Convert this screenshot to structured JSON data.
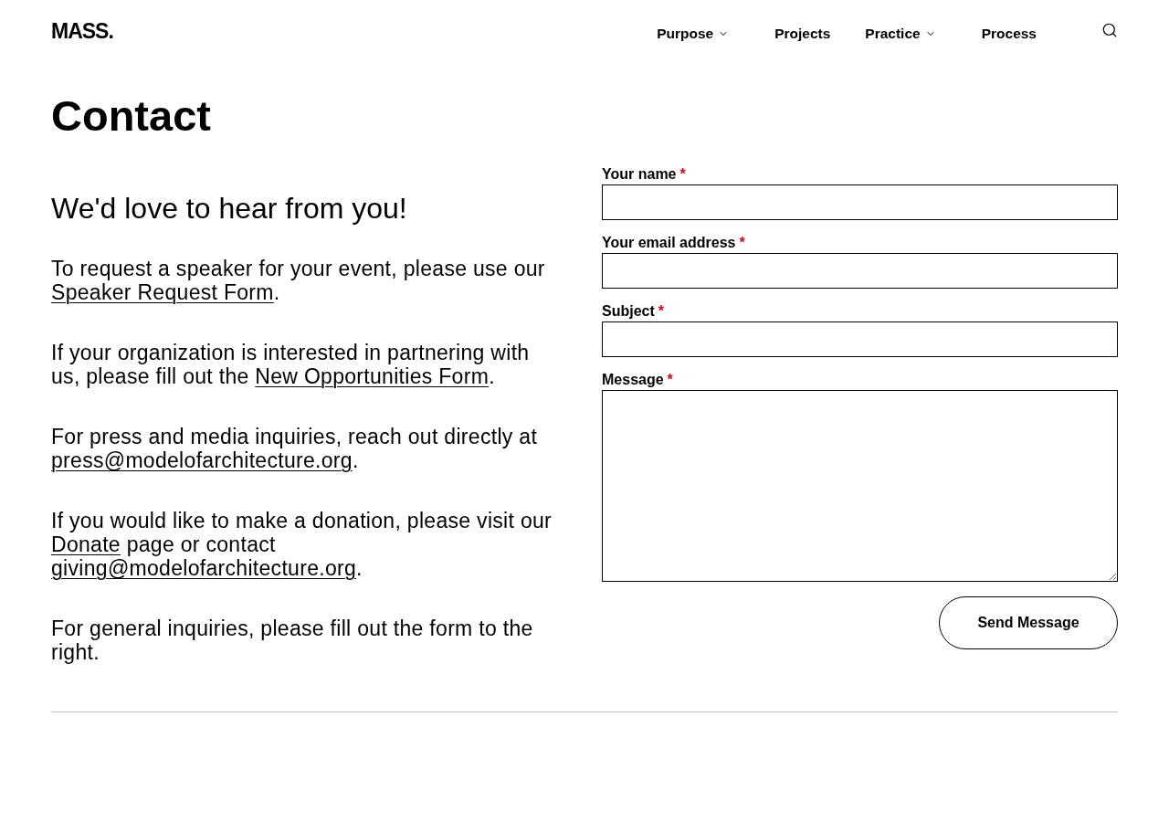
{
  "header": {
    "logo": "MASS.",
    "nav": [
      {
        "label": "Purpose",
        "dropdown": true
      },
      {
        "label": "Projects",
        "dropdown": false
      },
      {
        "label": "Practice",
        "dropdown": true
      },
      {
        "label": "Process",
        "dropdown": false
      }
    ]
  },
  "page_title": "Contact",
  "intro": {
    "heading": "We'd love to hear from you!",
    "paragraphs": [
      {
        "parts": [
          {
            "kind": "text",
            "text": "To request a speaker for your event, please use our "
          },
          {
            "kind": "link",
            "text": "Speaker Request Form"
          },
          {
            "kind": "text",
            "text": "."
          }
        ]
      },
      {
        "parts": [
          {
            "kind": "text",
            "text": "If your organization is interested in partnering with us, please fill out the "
          },
          {
            "kind": "link",
            "text": "New Opportunities Form"
          },
          {
            "kind": "text",
            "text": "."
          }
        ]
      },
      {
        "parts": [
          {
            "kind": "text",
            "text": "For press and media inquiries, reach out directly at "
          },
          {
            "kind": "email",
            "text": "press@modelofarchitecture.org"
          },
          {
            "kind": "text",
            "text": "."
          }
        ]
      },
      {
        "parts": [
          {
            "kind": "text",
            "text": "If you would like to make a donation, please visit our "
          },
          {
            "kind": "link",
            "text": "Donate"
          },
          {
            "kind": "text",
            "text": " page or contact "
          },
          {
            "kind": "email",
            "text": "giving@modelofarchitecture.org"
          },
          {
            "kind": "text",
            "text": "."
          }
        ]
      },
      {
        "parts": [
          {
            "kind": "text",
            "text": "For general inquiries, please fill out the form to the right."
          }
        ]
      }
    ]
  },
  "form": {
    "required_mark": "*",
    "fields": [
      {
        "kind": "text",
        "label": "Your name",
        "required": true
      },
      {
        "kind": "email",
        "label": "Your email address",
        "required": true
      },
      {
        "kind": "text",
        "label": "Subject",
        "required": true
      },
      {
        "kind": "textarea",
        "label": "Message",
        "required": true
      }
    ],
    "submit": "Send Message"
  }
}
